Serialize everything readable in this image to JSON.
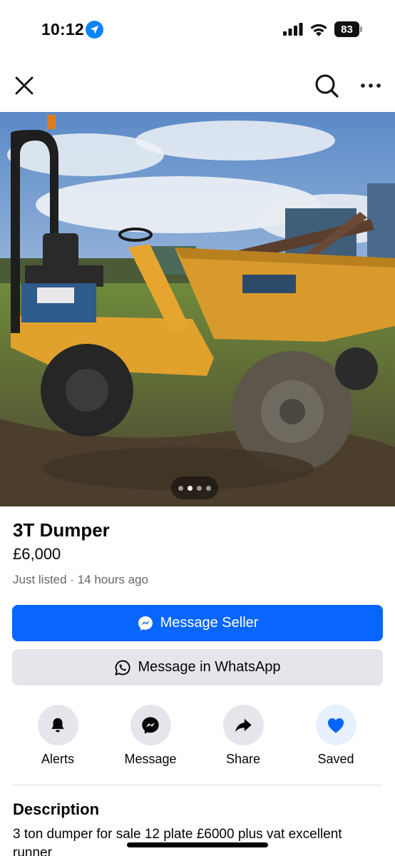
{
  "status_bar": {
    "time": "10:12",
    "battery": "83"
  },
  "nav": {
    "close_icon": "close-icon",
    "search_icon": "search-icon",
    "more_icon": "more-icon"
  },
  "listing": {
    "title": "3T Dumper",
    "price": "£6,000",
    "listed": "Just listed · 14 hours ago",
    "photo_count": 4,
    "active_photo": 1
  },
  "buttons": {
    "message_seller": "Message Seller",
    "whatsapp": "Message in WhatsApp"
  },
  "actions": [
    {
      "label": "Alerts",
      "icon": "bell-icon"
    },
    {
      "label": "Message",
      "icon": "messenger-icon"
    },
    {
      "label": "Share",
      "icon": "share-icon"
    },
    {
      "label": "Saved",
      "icon": "heart-icon"
    }
  ],
  "description": {
    "heading": "Description",
    "text": "3 ton dumper for sale 12 plate £6000 plus vat excellent runner"
  },
  "colors": {
    "primary": "#0866ff",
    "secondary_bg": "#e4e6eb",
    "muted_text": "#65676b"
  }
}
